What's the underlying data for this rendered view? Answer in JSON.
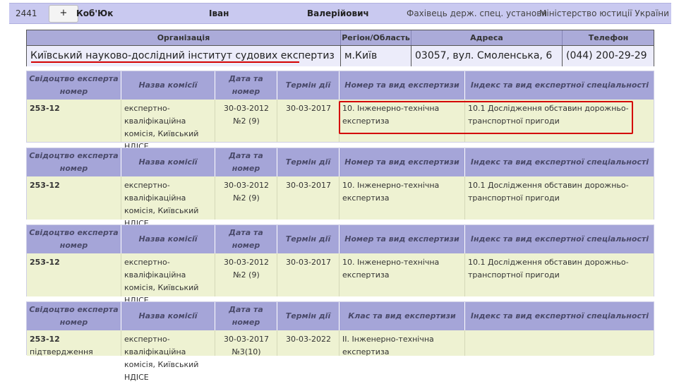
{
  "person": {
    "id": "2441",
    "add_button": "+",
    "last_name": "Коб'Юк",
    "first_name": "Іван",
    "patronymic": "Валерійович",
    "position": "Фахівець держ. спец. установи",
    "ministry": "Міністерство юстиції України"
  },
  "organization": {
    "headers": [
      "Організація",
      "Регіон/Область",
      "Адреса",
      "Телефон"
    ],
    "name": "Київський науково-дослідний інститут судових експертиз",
    "region": "м.Київ",
    "address": "03057, вул. Смоленська, 6",
    "phone": "(044) 200-29-29"
  },
  "accent_colors": {
    "header_bg": "#c9c9f0",
    "table_head_bg": "#a5a5d8",
    "row_bg": "#eef2d2",
    "highlight": "#d40000"
  },
  "certificates": [
    {
      "headers": [
        "Свідоцтво експерта номер",
        "Назва комісії",
        "Дата та номер рішення",
        "Термін дії",
        "Номер та вид експертизи",
        "Індекс та вид експертної спеціальності"
      ],
      "cert_number": "253-12",
      "cert_extra": "",
      "commission": "експертно-кваліфікаційна комісія, Київський НДІСЕ",
      "decision": "30-03-2012 №2 (9)",
      "term": "30-03-2017",
      "expertise": "10. Інженерно-технічна експертиза",
      "specialty": "10.1 Дослідження обставин дорожньо-транспортної пригоди"
    },
    {
      "headers": [
        "Свідоцтво експерта номер",
        "Назва комісії",
        "Дата та номер рішення",
        "Термін дії",
        "Номер та вид експертизи",
        "Індекс та вид експертної спеціальності"
      ],
      "cert_number": "253-12",
      "cert_extra": "",
      "commission": "експертно-кваліфікаційна комісія, Київський НДІСЕ",
      "decision": "30-03-2012 №2 (9)",
      "term": "30-03-2017",
      "expertise": "10. Інженерно-технічна експертиза",
      "specialty": "10.1 Дослідження обставин дорожньо-транспортної пригоди"
    },
    {
      "headers": [
        "Свідоцтво експерта номер",
        "Назва комісії",
        "Дата та номер рішення",
        "Термін дії",
        "Номер та вид експертизи",
        "Індекс та вид експертної спеціальності"
      ],
      "cert_number": "253-12",
      "cert_extra": "",
      "commission": "експертно-кваліфікаційна комісія, Київський НДІСЕ",
      "decision": "30-03-2012 №2 (9)",
      "term": "30-03-2017",
      "expertise": "10. Інженерно-технічна експертиза",
      "specialty": "10.1 Дослідження обставин дорожньо-транспортної пригоди"
    },
    {
      "headers": [
        "Свідоцтво експерта номер",
        "Назва комісії",
        "Дата та номер рішення",
        "Термін дії",
        "Клас та вид експертизи",
        "Індекс та вид експертної спеціальності"
      ],
      "cert_number": "253-12",
      "cert_extra": "підтвердження",
      "commission": "експертно-кваліфікаційна комісія, Київський НДІСЕ",
      "decision": "30-03-2017 №3(10)",
      "term": "30-03-2022",
      "expertise": "ІІ. Інженерно-технічна експертиза",
      "specialty": ""
    }
  ]
}
